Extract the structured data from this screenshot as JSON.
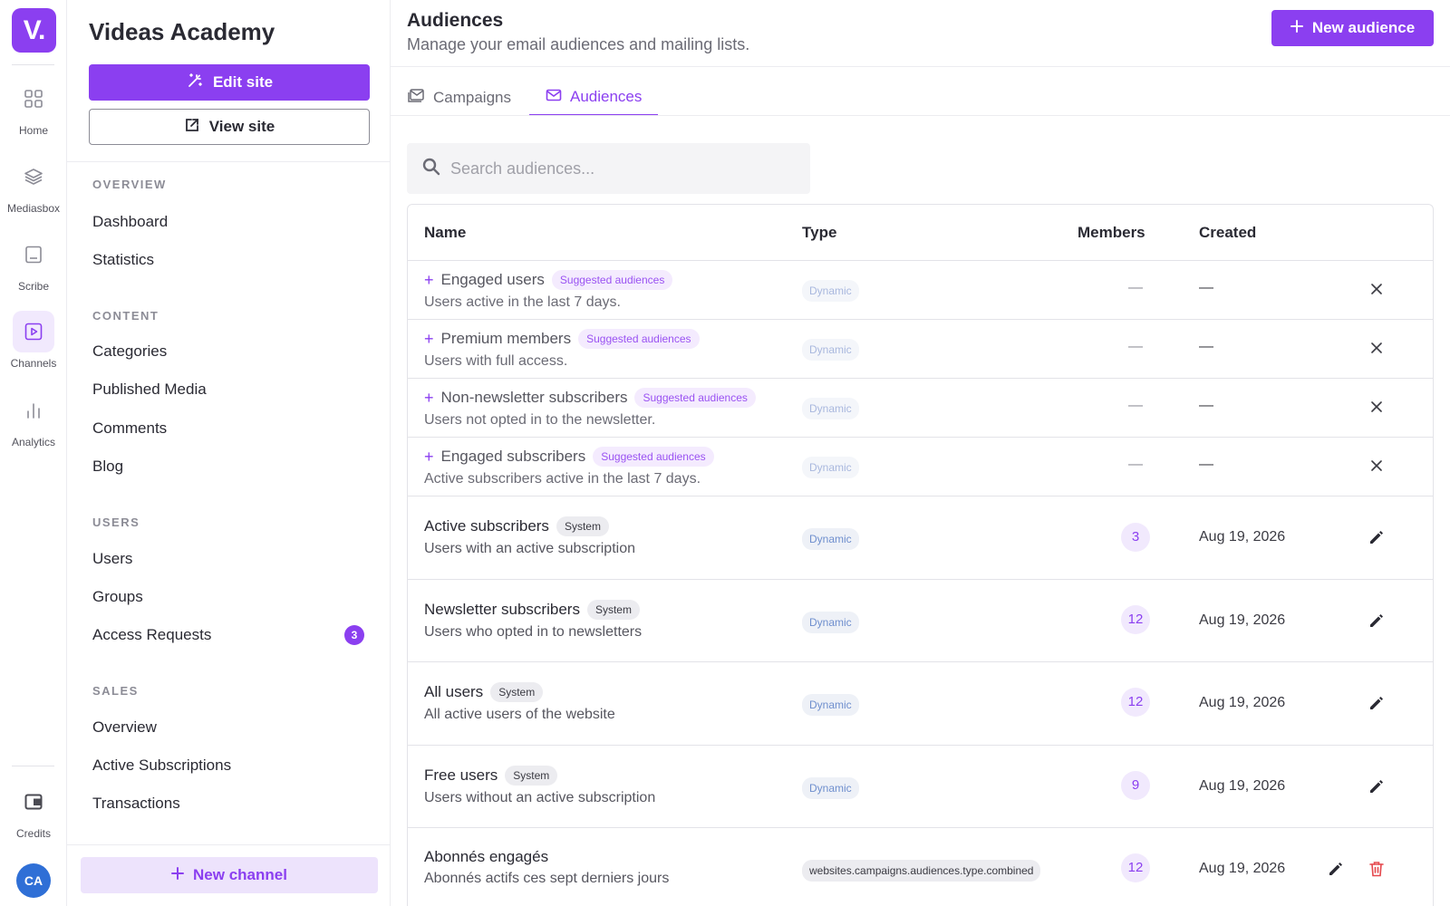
{
  "rail": {
    "logo": "V.",
    "items": [
      {
        "label": "Home",
        "icon": "grid-icon"
      },
      {
        "label": "Mediasbox",
        "icon": "layers-icon"
      },
      {
        "label": "Scribe",
        "icon": "document-icon"
      },
      {
        "label": "Channels",
        "icon": "play-icon"
      },
      {
        "label": "Analytics",
        "icon": "bar-chart-icon"
      }
    ],
    "credits_label": "Credits",
    "avatar": "CA"
  },
  "sidebar": {
    "site_name": "Videas Academy",
    "edit_site": "Edit site",
    "view_site": "View site",
    "sections": {
      "overview": "OVERVIEW",
      "content": "CONTENT",
      "users": "USERS",
      "sales": "SALES"
    },
    "overview_items": [
      "Dashboard",
      "Statistics"
    ],
    "content_items": [
      "Categories",
      "Published Media",
      "Comments",
      "Blog"
    ],
    "users_items": [
      "Users",
      "Groups",
      "Access Requests"
    ],
    "access_requests_count": "3",
    "sales_items": [
      "Overview",
      "Active Subscriptions",
      "Transactions"
    ],
    "new_channel": "New channel"
  },
  "header": {
    "title": "Audiences",
    "subtitle": "Manage your email audiences and mailing lists.",
    "new_audience": "New audience"
  },
  "tabs": [
    {
      "label": "Campaigns",
      "active": false
    },
    {
      "label": "Audiences",
      "active": true
    }
  ],
  "search": {
    "placeholder": "Search audiences..."
  },
  "table": {
    "columns": [
      "Name",
      "Type",
      "Members",
      "Created"
    ],
    "suggested_rows": [
      {
        "name": "Engaged users",
        "tag": "Suggested audiences",
        "desc": "Users active in the last 7 days.",
        "type": "Dynamic",
        "members": "—",
        "created": "—"
      },
      {
        "name": "Premium members",
        "tag": "Suggested audiences",
        "desc": "Users with full access.",
        "type": "Dynamic",
        "members": "—",
        "created": "—"
      },
      {
        "name": "Non-newsletter subscribers",
        "tag": "Suggested audiences",
        "desc": "Users not opted in to the newsletter.",
        "type": "Dynamic",
        "members": "—",
        "created": "—"
      },
      {
        "name": "Engaged subscribers",
        "tag": "Suggested audiences",
        "desc": "Active subscribers active in the last 7 days.",
        "type": "Dynamic",
        "members": "—",
        "created": "—"
      }
    ],
    "rows": [
      {
        "name": "Active subscribers",
        "tag": "System",
        "desc": "Users with an active subscription",
        "type": "Dynamic",
        "members": "3",
        "created": "Aug 19, 2026"
      },
      {
        "name": "Newsletter subscribers",
        "tag": "System",
        "desc": "Users who opted in to newsletters",
        "type": "Dynamic",
        "members": "12",
        "created": "Aug 19, 2026"
      },
      {
        "name": "All users",
        "tag": "System",
        "desc": "All active users of the website",
        "type": "Dynamic",
        "members": "12",
        "created": "Aug 19, 2026"
      },
      {
        "name": "Free users",
        "tag": "System",
        "desc": "Users without an active subscription",
        "type": "Dynamic",
        "members": "9",
        "created": "Aug 19, 2026"
      },
      {
        "name": "Abonnés engagés",
        "tag": "",
        "desc": "Abonnés actifs ces sept derniers jours",
        "type": "websites.campaigns.audiences.type.combined",
        "members": "12",
        "created": "Aug 19, 2026"
      }
    ]
  },
  "colors": {
    "accent": "#8b3ff0",
    "accent_light": "#f1e9fd",
    "danger": "#e5484d"
  }
}
